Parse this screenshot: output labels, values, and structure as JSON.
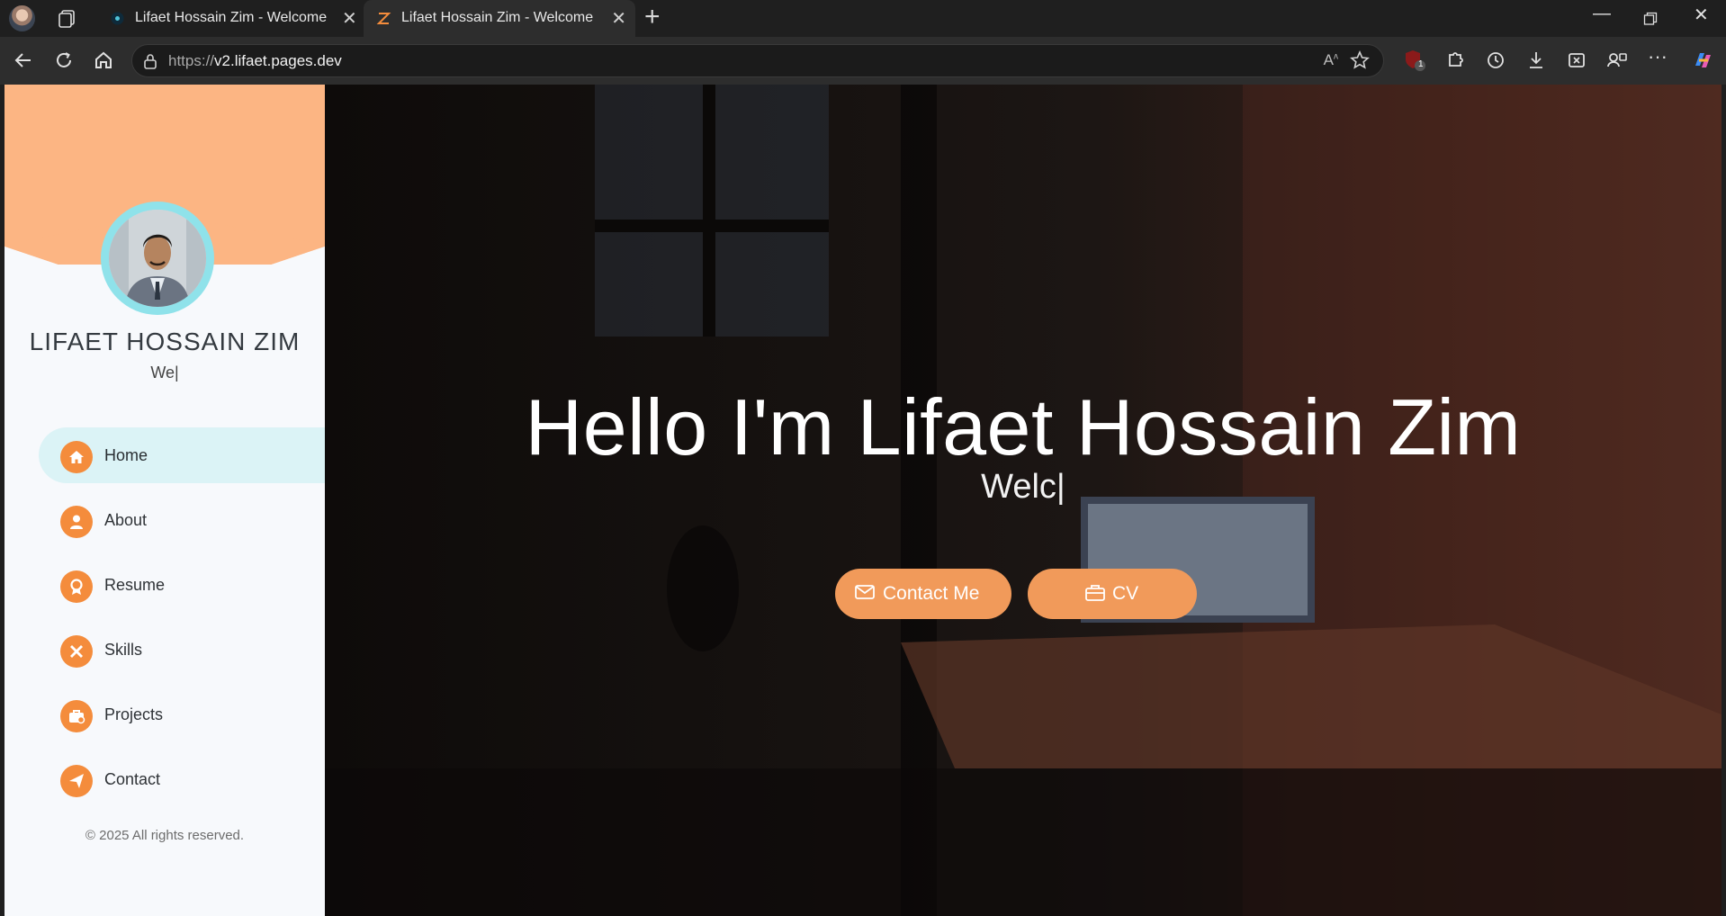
{
  "browser": {
    "tabs": [
      {
        "title": "Lifaet Hossain Zim - Welcome",
        "active": false
      },
      {
        "title": "Lifaet Hossain Zim - Welcome",
        "active": true
      }
    ],
    "url_scheme": "https://",
    "url_host": "v2.lifaet.pages.dev",
    "ublock_badge": "1"
  },
  "sidebar": {
    "name": "LIFAET HOSSAIN ZIM",
    "typed_text": "We|",
    "menu": [
      {
        "label": "Home",
        "icon": "home-icon",
        "active": true
      },
      {
        "label": "About",
        "icon": "user-icon",
        "active": false
      },
      {
        "label": "Resume",
        "icon": "award-icon",
        "active": false
      },
      {
        "label": "Skills",
        "icon": "tools-icon",
        "active": false
      },
      {
        "label": "Projects",
        "icon": "briefcase-icon",
        "active": false
      },
      {
        "label": "Contact",
        "icon": "paper-plane-icon",
        "active": false
      }
    ],
    "copyright": "© 2025 All rights reserved."
  },
  "hero": {
    "heading": "Hello I'm Lifaet Hossain Zim",
    "typed_text": "Welc|",
    "contact_button": "Contact Me",
    "cv_button": "CV"
  },
  "colors": {
    "accent": "#f48c3c",
    "sidebar_header": "#fcb583",
    "active_menu_bg": "#dbf3f6",
    "avatar_ring": "#8fe2ea"
  }
}
